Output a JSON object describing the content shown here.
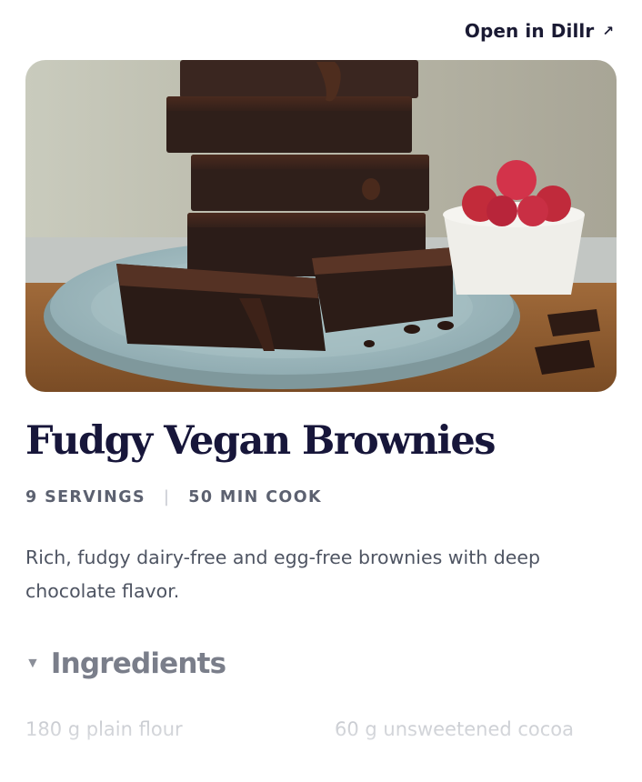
{
  "header": {
    "open_link_label": "Open in Dillr",
    "open_link_icon": "external-arrow-icon"
  },
  "recipe": {
    "title": "Fudgy Vegan Brownies",
    "servings": "9 SERVINGS",
    "cook_time": "50 MIN COOK",
    "separator": "|",
    "description": "Rich, fudgy dairy-free and egg-free brownies with deep chocolate flavor."
  },
  "ingredients_section": {
    "toggle_icon": "triangle-down-icon",
    "heading": "Ingredients",
    "items": [
      "180 g plain flour",
      "60 g unsweetened cocoa"
    ]
  },
  "colors": {
    "title": "#17163a",
    "meta": "#5c6170",
    "body": "#4e5462",
    "faded": "#c3c6cc"
  }
}
